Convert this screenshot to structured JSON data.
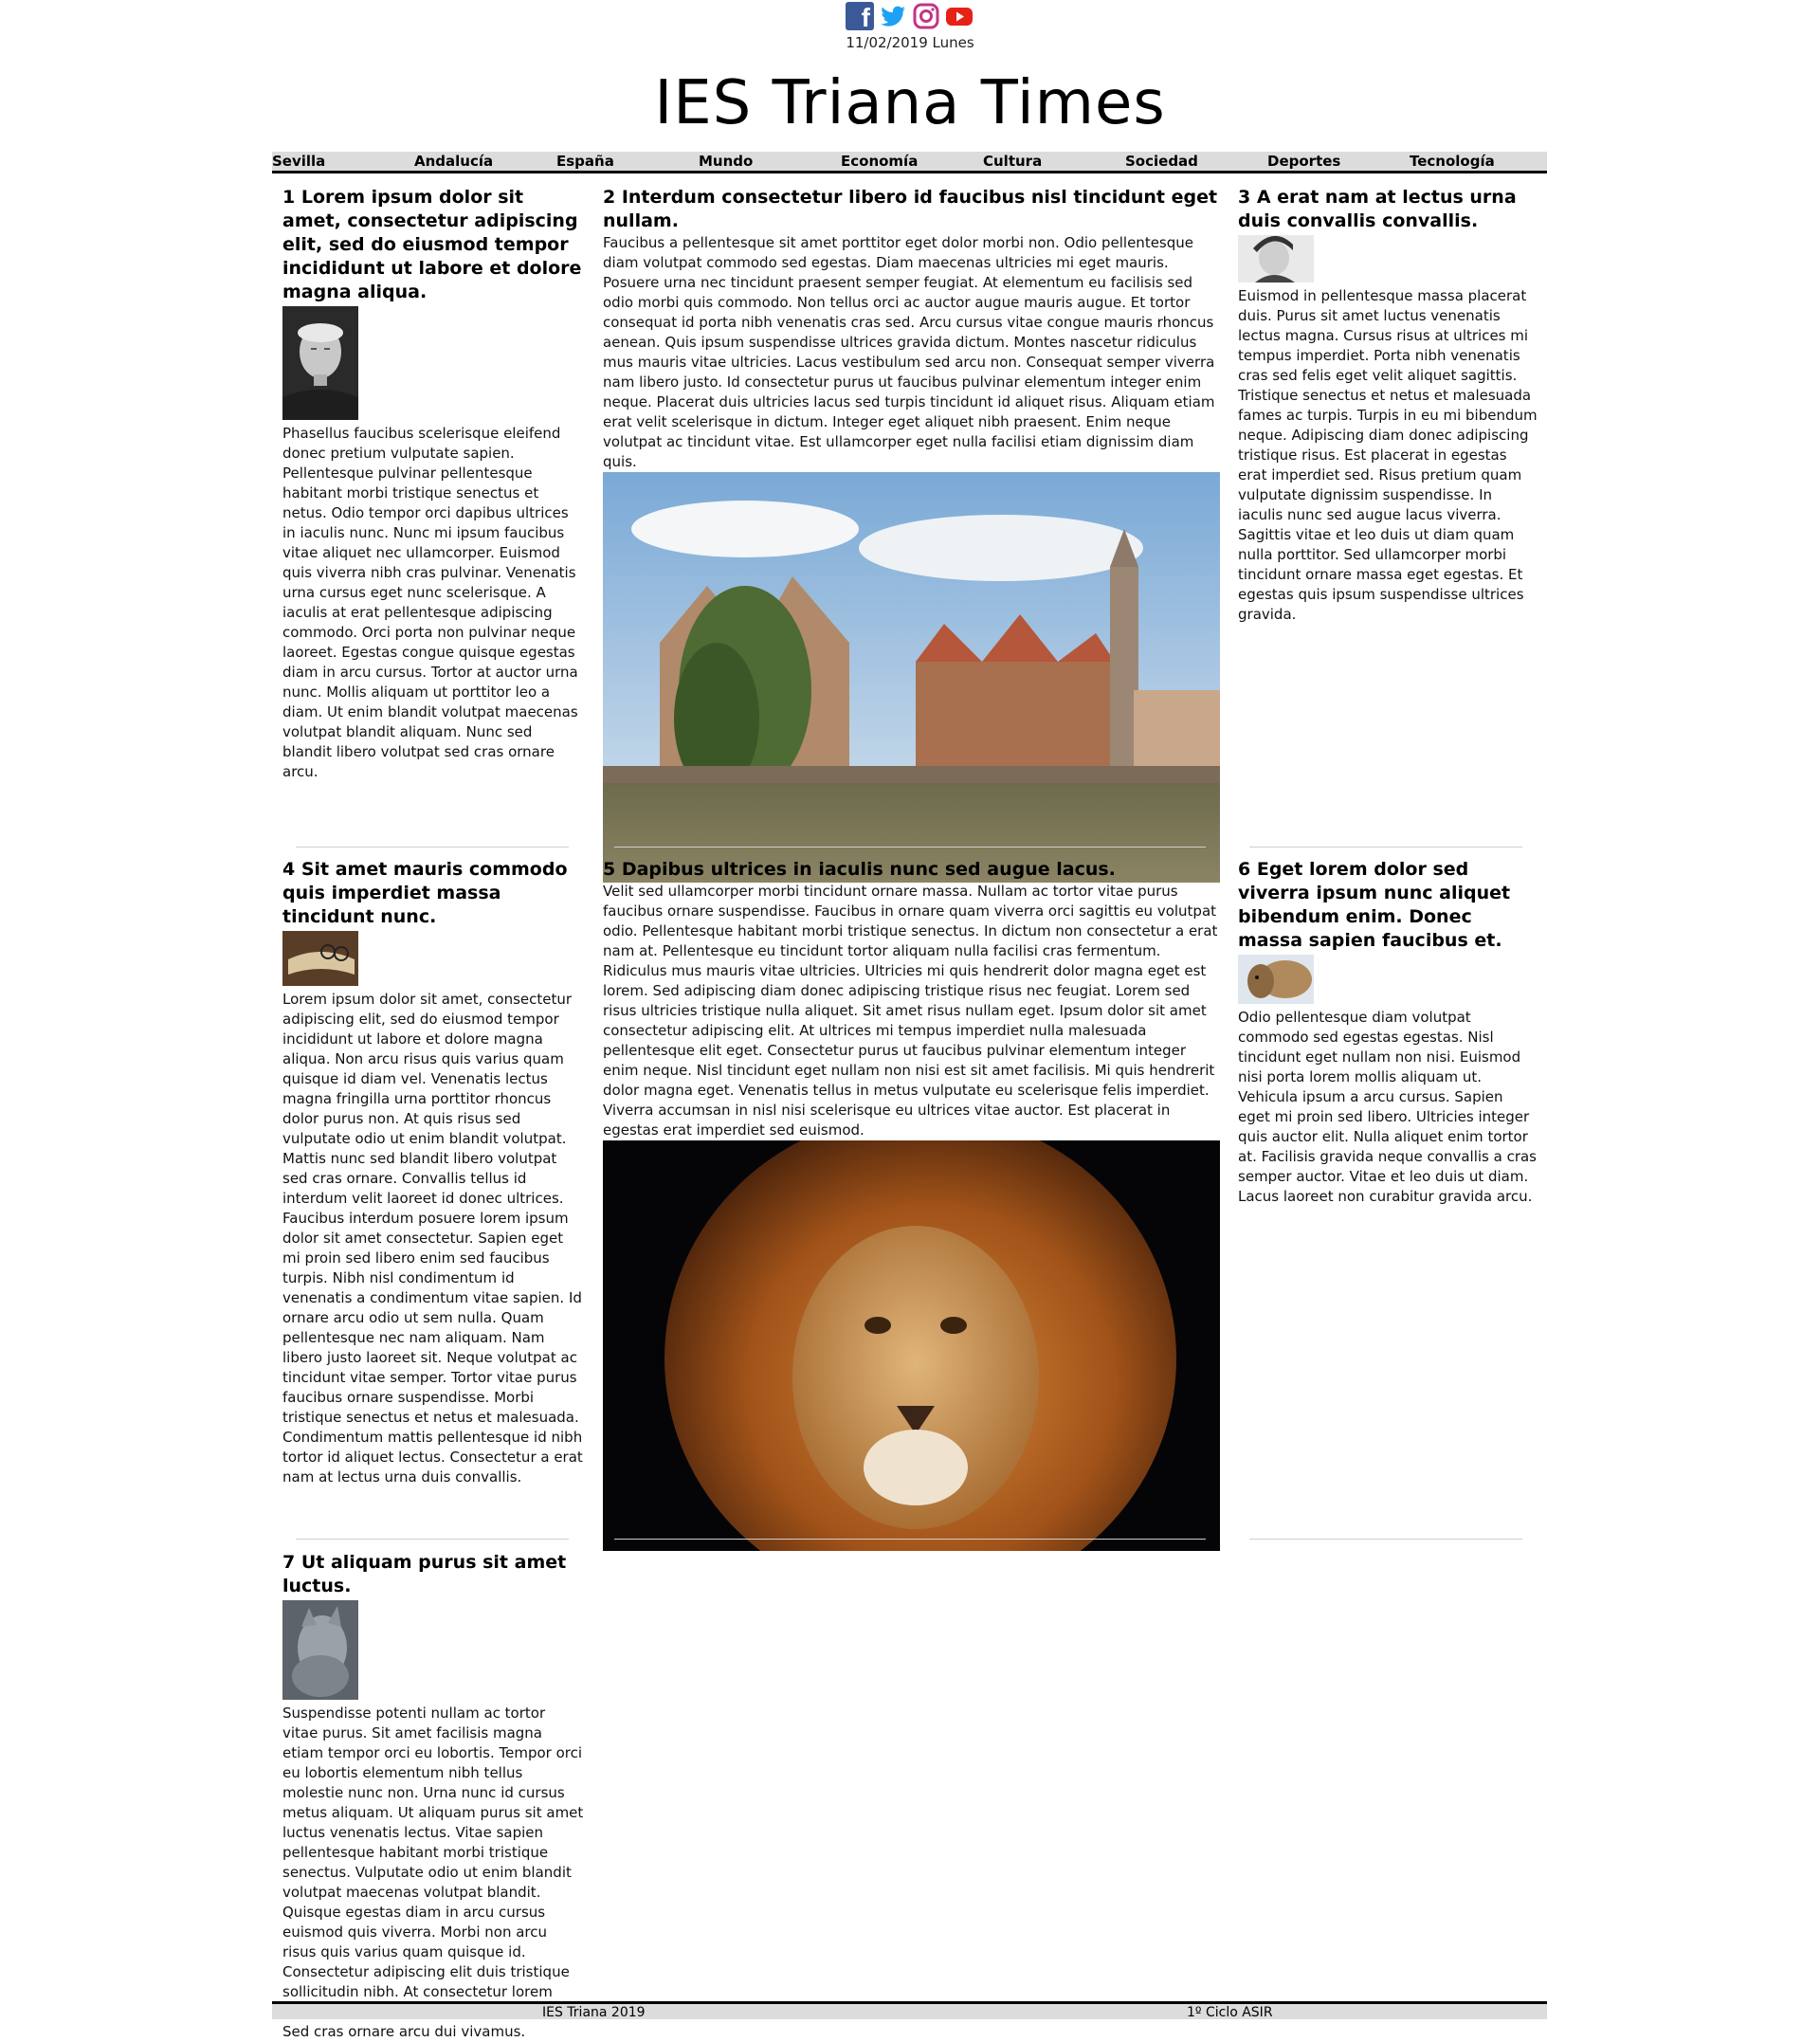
{
  "header": {
    "social": [
      "facebook-icon",
      "twitter-icon",
      "instagram-icon",
      "youtube-icon"
    ],
    "date": "11/02/2019 Lunes",
    "title": "IES Triana Times"
  },
  "nav": {
    "items": [
      "Sevilla",
      "Andalucía",
      "España",
      "Mundo",
      "Economía",
      "Cultura",
      "Sociedad",
      "Deportes",
      "Tecnología"
    ]
  },
  "articles": [
    {
      "title": "1 Lorem ipsum dolor sit amet, consectetur adipiscing elit, sed do eiusmod tempor incididunt ut labore et dolore magna aliqua.",
      "body": "Phasellus faucibus scelerisque eleifend donec pretium vulputate sapien. Pellentesque pulvinar pellentesque habitant morbi tristique senectus et netus. Odio tempor orci dapibus ultrices in iaculis nunc. Nunc mi ipsum faucibus vitae aliquet nec ullamcorper. Euismod quis viverra nibh cras pulvinar. Venenatis urna cursus eget nunc scelerisque. A iaculis at erat pellentesque adipiscing commodo. Orci porta non pulvinar neque laoreet. Egestas congue quisque egestas diam in arcu cursus. Tortor at auctor urna nunc. Mollis aliquam ut porttitor leo a diam. Ut enim blandit volutpat maecenas volutpat blandit aliquam. Nunc sed blandit libero volutpat sed cras ornare arcu."
    },
    {
      "title": "2 Interdum consectetur libero id faucibus nisl tincidunt eget nullam.",
      "body": "Faucibus a pellentesque sit amet porttitor eget dolor morbi non. Odio pellentesque diam volutpat commodo sed egestas. Diam maecenas ultricies mi eget mauris. Posuere urna nec tincidunt praesent semper feugiat. At elementum eu facilisis sed odio morbi quis commodo. Non tellus orci ac auctor augue mauris augue. Et tortor consequat id porta nibh venenatis cras sed. Arcu cursus vitae congue mauris rhoncus aenean. Quis ipsum suspendisse ultrices gravida dictum. Montes nascetur ridiculus mus mauris vitae ultricies. Lacus vestibulum sed arcu non. Consequat semper viverra nam libero justo. Id consectetur purus ut faucibus pulvinar elementum integer enim neque. Placerat duis ultricies lacus sed turpis tincidunt id aliquet risus. Aliquam etiam erat velit scelerisque in dictum. Integer eget aliquet nibh praesent. Enim neque volutpat ac tincidunt vitae. Est ullamcorper eget nulla facilisi etiam dignissim diam quis."
    },
    {
      "title": "3 A erat nam at lectus urna duis convallis convallis.",
      "body": "Euismod in pellentesque massa placerat duis. Purus sit amet luctus venenatis lectus magna. Cursus risus at ultrices mi tempus imperdiet. Porta nibh venenatis cras sed felis eget velit aliquet sagittis. Tristique senectus et netus et malesuada fames ac turpis. Turpis in eu mi bibendum neque. Adipiscing diam donec adipiscing tristique risus. Est placerat in egestas erat imperdiet sed. Risus pretium quam vulputate dignissim suspendisse. In iaculis nunc sed augue lacus viverra. Sagittis vitae et leo duis ut diam quam nulla porttitor. Sed ullamcorper morbi tincidunt ornare massa eget egestas. Et egestas quis ipsum suspendisse ultrices gravida."
    },
    {
      "title": "4 Sit amet mauris commodo quis imperdiet massa tincidunt nunc.",
      "body": "Lorem ipsum dolor sit amet, consectetur adipiscing elit, sed do eiusmod tempor incididunt ut labore et dolore magna aliqua. Non arcu risus quis varius quam quisque id diam vel. Venenatis lectus magna fringilla urna porttitor rhoncus dolor purus non. At quis risus sed vulputate odio ut enim blandit volutpat. Mattis nunc sed blandit libero volutpat sed cras ornare. Convallis tellus id interdum velit laoreet id donec ultrices. Faucibus interdum posuere lorem ipsum dolor sit amet consectetur. Sapien eget mi proin sed libero enim sed faucibus turpis. Nibh nisl condimentum id venenatis a condimentum vitae sapien. Id ornare arcu odio ut sem nulla. Quam pellentesque nec nam aliquam. Nam libero justo laoreet sit. Neque volutpat ac tincidunt vitae semper. Tortor vitae purus faucibus ornare suspendisse. Morbi tristique senectus et netus et malesuada. Condimentum mattis pellentesque id nibh tortor id aliquet lectus. Consectetur a erat nam at lectus urna duis convallis."
    },
    {
      "title": "5 Dapibus ultrices in iaculis nunc sed augue lacus.",
      "body": "Velit sed ullamcorper morbi tincidunt ornare massa. Nullam ac tortor vitae purus faucibus ornare suspendisse. Faucibus in ornare quam viverra orci sagittis eu volutpat odio. Pellentesque habitant morbi tristique senectus. In dictum non consectetur a erat nam at. Pellentesque eu tincidunt tortor aliquam nulla facilisi cras fermentum. Ridiculus mus mauris vitae ultricies. Ultricies mi quis hendrerit dolor magna eget est lorem. Sed adipiscing diam donec adipiscing tristique risus nec feugiat. Lorem sed risus ultricies tristique nulla aliquet. Sit amet risus nullam eget. Ipsum dolor sit amet consectetur adipiscing elit. At ultrices mi tempus imperdiet nulla malesuada pellentesque elit eget. Consectetur purus ut faucibus pulvinar elementum integer enim neque. Nisl tincidunt eget nullam non nisi est sit amet facilisis. Mi quis hendrerit dolor magna eget. Venenatis tellus in metus vulputate eu scelerisque felis imperdiet. Viverra accumsan in nisl nisi scelerisque eu ultrices vitae auctor. Est placerat in egestas erat imperdiet sed euismod."
    },
    {
      "title": "6 Eget lorem dolor sed viverra ipsum nunc aliquet bibendum enim. Donec massa sapien faucibus et.",
      "body": "Odio pellentesque diam volutpat commodo sed egestas egestas. Nisl tincidunt eget nullam non nisi. Euismod nisi porta lorem mollis aliquam ut. Vehicula ipsum a arcu cursus. Sapien eget mi proin sed libero. Ultricies integer quis auctor elit. Nulla aliquet enim tortor at. Facilisis gravida neque convallis a cras semper auctor. Vitae et leo duis ut diam. Lacus laoreet non curabitur gravida arcu."
    },
    {
      "title": "7 Ut aliquam purus sit amet luctus.",
      "body": "Suspendisse potenti nullam ac tortor vitae purus. Sit amet facilisis magna etiam tempor orci eu lobortis. Tempor orci eu lobortis elementum nibh tellus molestie nunc non. Urna nunc id cursus metus aliquam. Ut aliquam purus sit amet luctus venenatis lectus. Vitae sapien pellentesque habitant morbi tristique senectus. Vulputate odio ut enim blandit volutpat maecenas volutpat blandit. Quisque egestas diam in arcu cursus euismod quis viverra. Morbi non arcu risus quis varius quam quisque id. Consectetur adipiscing elit duis tristique sollicitudin nibh. At consectetur lorem donec massa sapien faucibus et molestie. Sed cras ornare arcu dui vivamus."
    }
  ],
  "footer": {
    "left": "IES Triana 2019",
    "right": "1º Ciclo ASIR"
  },
  "colors": {
    "nav_bg": "#dcdcdc",
    "facebook": "#3b5998",
    "twitter": "#1da1f2",
    "youtube": "#e62117",
    "instagram": "#c13584"
  }
}
